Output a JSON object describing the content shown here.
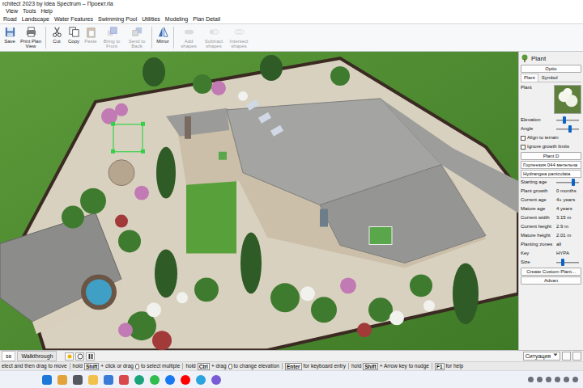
{
  "window": {
    "title": "rchitect 2023 by Idea Spectrum – Проект.rla"
  },
  "menu": [
    "View",
    "Tools",
    "Help"
  ],
  "ribbon_tabs": [
    {
      "label": "Road",
      "selected": false
    },
    {
      "label": "Landscape",
      "selected": false
    },
    {
      "label": "Water Features",
      "selected": false
    },
    {
      "label": "Swimming Pool",
      "selected": false
    },
    {
      "label": "Utilities",
      "selected": false
    },
    {
      "label": "Modeling",
      "selected": false
    },
    {
      "label": "Plan Detail",
      "selected": false
    }
  ],
  "toolbar": [
    [
      {
        "label": "Save",
        "disabled": false
      },
      {
        "label": "Print Plan View",
        "disabled": false
      }
    ],
    [
      {
        "label": "Cut",
        "disabled": false
      },
      {
        "label": "Copy",
        "disabled": false
      },
      {
        "label": "Paste",
        "disabled": true
      },
      {
        "label": "Bring to Front",
        "disabled": true
      },
      {
        "label": "Send to Back",
        "disabled": true
      }
    ],
    [
      {
        "label": "Mirror",
        "disabled": false
      }
    ],
    [
      {
        "label": "Add shapes",
        "disabled": true
      },
      {
        "label": "Subtract shapes",
        "disabled": true
      },
      {
        "label": "Intersect shapes",
        "disabled": true
      }
    ]
  ],
  "panel": {
    "title": "Plant",
    "options_button": "Optio",
    "tabs": [
      {
        "label": "Plant",
        "selected": true
      },
      {
        "label": "Symbol",
        "selected": false
      }
    ],
    "plant_label": "Plant",
    "rows": [
      {
        "kind": "slider",
        "label": "Elevation",
        "level": 0.35
      },
      {
        "kind": "slider",
        "label": "Angle",
        "level": 0.6
      },
      {
        "kind": "checkbox",
        "label": "Align to terrain",
        "checked": false
      },
      {
        "kind": "checkbox",
        "label": "Ignore growth limits",
        "checked": false
      },
      {
        "kind": "button",
        "label": "Plant D"
      },
      {
        "kind": "text",
        "label": "Гортензия 044 метельча"
      },
      {
        "kind": "text",
        "label": "Hydrangea paniculata"
      },
      {
        "kind": "slider",
        "label": "Starting age",
        "level": 0.75
      },
      {
        "kind": "field",
        "label": "Plant growth",
        "value": "0 months"
      },
      {
        "kind": "field",
        "label": "Current age",
        "value": "4+ years"
      },
      {
        "kind": "field",
        "label": "Mature age",
        "value": "4 years"
      },
      {
        "kind": "field",
        "label": "Current width",
        "value": "3.15 m"
      },
      {
        "kind": "field",
        "label": "Current height",
        "value": "2.9 m"
      },
      {
        "kind": "field",
        "label": "Mature height",
        "value": "2.01 m"
      },
      {
        "kind": "field",
        "label": "Planting zones",
        "value": "all"
      },
      {
        "kind": "field",
        "label": "Key",
        "value": "HYPA"
      },
      {
        "kind": "slider",
        "label": "Size",
        "level": 0.3
      },
      {
        "kind": "button",
        "label": "Create Custom Plant..."
      },
      {
        "kind": "button",
        "label": "Advan"
      }
    ]
  },
  "view_tabs": [
    {
      "label": "se",
      "selected": true
    },
    {
      "label": "Walkthrough",
      "selected": false
    }
  ],
  "scene_select": {
    "value": "Ситуация"
  },
  "status_bar": [
    [
      {
        "kind": "text",
        "text": "elect and then drag to move"
      }
    ],
    [
      {
        "kind": "text",
        "text": "hold"
      },
      {
        "kind": "key",
        "text": "Shift"
      },
      {
        "kind": "text",
        "text": "+ click or drag"
      },
      {
        "kind": "mouse"
      },
      {
        "kind": "text",
        "text": "to select multiple"
      }
    ],
    [
      {
        "kind": "text",
        "text": "hold"
      },
      {
        "kind": "key",
        "text": "Ctrl"
      },
      {
        "kind": "text",
        "text": "+ drag"
      },
      {
        "kind": "mouse"
      },
      {
        "kind": "text",
        "text": "to change elevation"
      }
    ],
    [
      {
        "kind": "key",
        "text": "Enter"
      },
      {
        "kind": "text",
        "text": "for keyboard entry"
      }
    ],
    [
      {
        "kind": "text",
        "text": "hold"
      },
      {
        "kind": "key",
        "text": "Shift"
      },
      {
        "kind": "text",
        "text": "+ Arrow key to nudge"
      }
    ],
    [
      {
        "kind": "key",
        "text": "F1"
      },
      {
        "kind": "text",
        "text": "for help"
      }
    ]
  ]
}
